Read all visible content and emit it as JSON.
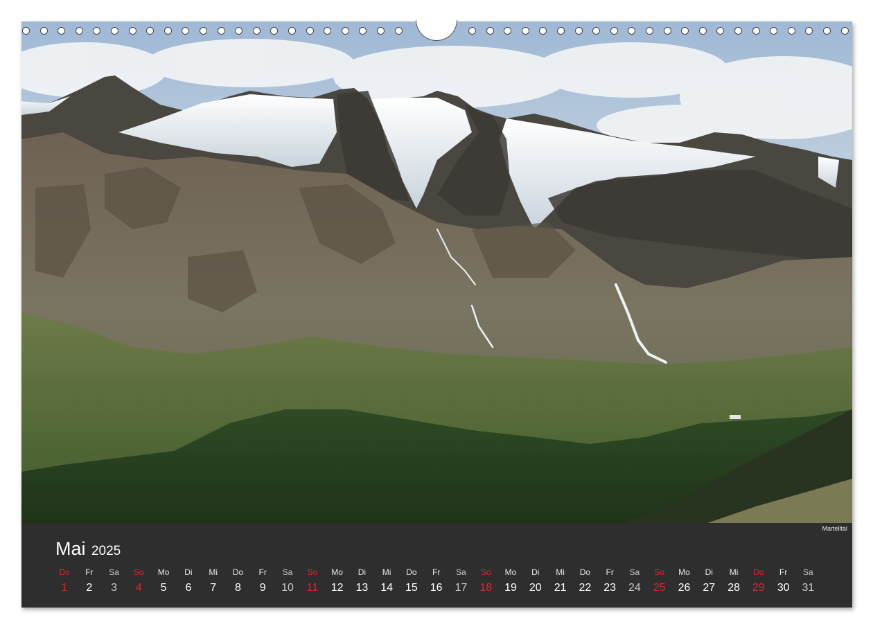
{
  "photo": {
    "caption": "Martelltal",
    "subject": "mountain-glacier-valley-photo"
  },
  "calendar": {
    "month": "Mai",
    "year": "2025",
    "days": [
      {
        "dow": "Do",
        "num": "1",
        "type": "holiday"
      },
      {
        "dow": "Fr",
        "num": "2",
        "type": "weekday"
      },
      {
        "dow": "Sa",
        "num": "3",
        "type": "saturday"
      },
      {
        "dow": "So",
        "num": "4",
        "type": "sunday"
      },
      {
        "dow": "Mo",
        "num": "5",
        "type": "weekday"
      },
      {
        "dow": "Di",
        "num": "6",
        "type": "weekday"
      },
      {
        "dow": "Mi",
        "num": "7",
        "type": "weekday"
      },
      {
        "dow": "Do",
        "num": "8",
        "type": "weekday"
      },
      {
        "dow": "Fr",
        "num": "9",
        "type": "weekday"
      },
      {
        "dow": "Sa",
        "num": "10",
        "type": "saturday"
      },
      {
        "dow": "So",
        "num": "11",
        "type": "sunday"
      },
      {
        "dow": "Mo",
        "num": "12",
        "type": "weekday"
      },
      {
        "dow": "Di",
        "num": "13",
        "type": "weekday"
      },
      {
        "dow": "Mi",
        "num": "14",
        "type": "weekday"
      },
      {
        "dow": "Do",
        "num": "15",
        "type": "weekday"
      },
      {
        "dow": "Fr",
        "num": "16",
        "type": "weekday"
      },
      {
        "dow": "Sa",
        "num": "17",
        "type": "saturday"
      },
      {
        "dow": "So",
        "num": "18",
        "type": "sunday"
      },
      {
        "dow": "Mo",
        "num": "19",
        "type": "weekday"
      },
      {
        "dow": "Di",
        "num": "20",
        "type": "weekday"
      },
      {
        "dow": "Mi",
        "num": "21",
        "type": "weekday"
      },
      {
        "dow": "Do",
        "num": "22",
        "type": "weekday"
      },
      {
        "dow": "Fr",
        "num": "23",
        "type": "weekday"
      },
      {
        "dow": "Sa",
        "num": "24",
        "type": "saturday"
      },
      {
        "dow": "So",
        "num": "25",
        "type": "sunday"
      },
      {
        "dow": "Mo",
        "num": "26",
        "type": "weekday"
      },
      {
        "dow": "Di",
        "num": "27",
        "type": "weekday"
      },
      {
        "dow": "Mi",
        "num": "28",
        "type": "weekday"
      },
      {
        "dow": "Do",
        "num": "29",
        "type": "holiday"
      },
      {
        "dow": "Fr",
        "num": "30",
        "type": "weekday"
      },
      {
        "dow": "Sa",
        "num": "31",
        "type": "saturday"
      }
    ]
  },
  "colors": {
    "panel": "#2e2e2e",
    "sunday": "#e0262a",
    "text": "#ffffff",
    "saturday": "#c8c8c8"
  }
}
